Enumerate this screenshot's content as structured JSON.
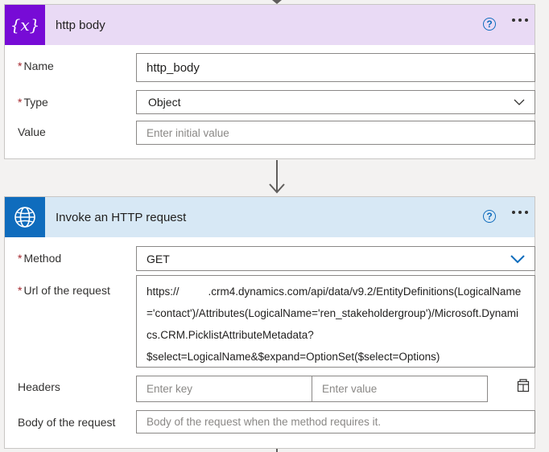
{
  "card1": {
    "title": "http body",
    "icon": "variable-icon",
    "icon_glyph": "{x}",
    "header_color": "#e9daf5",
    "tile_color": "#770bd6",
    "fields": {
      "name_label": "Name",
      "name_value": "http_body",
      "type_label": "Type",
      "type_value": "Object",
      "value_label": "Value",
      "value_placeholder": "Enter initial value"
    }
  },
  "card2": {
    "title": "Invoke an HTTP request",
    "icon": "globe-icon",
    "header_color": "#d7e8f5",
    "tile_color": "#0f6cbd",
    "fields": {
      "method_label": "Method",
      "method_value": "GET",
      "url_label": "Url of the request",
      "url_line1_a": "https://",
      "url_line1_b": ".crm4.dynamics.com/api/data/v9.2/EntityDefinitions(LogicalName",
      "url_line2": "='contact')/Attributes(LogicalName='ren_stakeholdergroup')/Microsoft.Dynami",
      "url_line3": "cs.CRM.PicklistAttributeMetadata?",
      "url_line4": "$select=LogicalName&$expand=OptionSet($select=Options)",
      "headers_label": "Headers",
      "header_key_placeholder": "Enter key",
      "header_value_placeholder": "Enter value",
      "body_label": "Body of the request",
      "body_placeholder": "Body of the request when the method requires it."
    }
  },
  "required_marker": "*"
}
